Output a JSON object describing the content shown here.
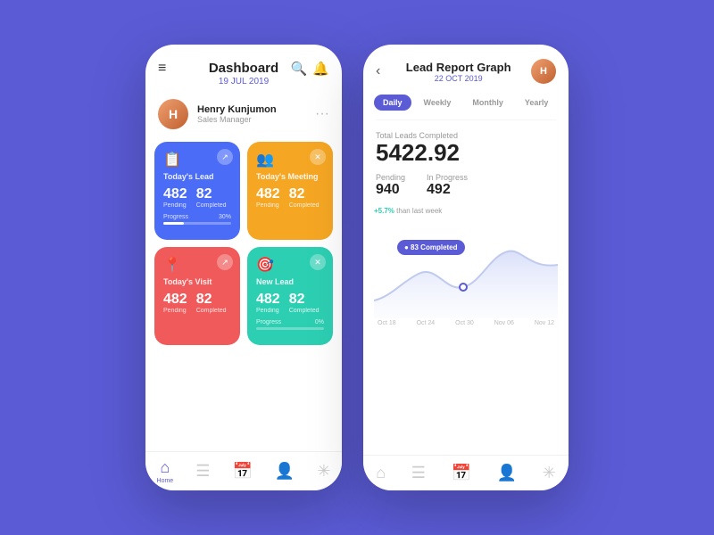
{
  "left_phone": {
    "header": {
      "title": "Dashboard",
      "date": "19 JUL 2019"
    },
    "profile": {
      "name": "Henry Kunjumon",
      "role": "Sales Manager",
      "avatar_initials": "H"
    },
    "cards": [
      {
        "id": "todays-lead",
        "title": "Today's Lead",
        "color": "blue",
        "pending": "482",
        "completed": "82",
        "progress_label": "Progress",
        "progress_pct": "30%",
        "progress_value": 30,
        "icon": "📋"
      },
      {
        "id": "todays-meeting",
        "title": "Today's Meeting",
        "color": "orange",
        "pending": "482",
        "completed": "82",
        "icon": "👥"
      },
      {
        "id": "todays-visit",
        "title": "Today's Visit",
        "color": "red",
        "pending": "482",
        "completed": "82",
        "icon": "📍"
      },
      {
        "id": "new-lead",
        "title": "New Lead",
        "color": "teal",
        "pending": "482",
        "completed": "82",
        "progress_label": "Progress",
        "progress_pct": "0%",
        "progress_value": 0,
        "icon": "🎯"
      }
    ],
    "nav_items": [
      {
        "id": "home",
        "label": "Home",
        "active": true,
        "icon": "⌂"
      },
      {
        "id": "docs",
        "label": "",
        "active": false,
        "icon": "☰"
      },
      {
        "id": "calendar",
        "label": "",
        "active": false,
        "icon": "📅"
      },
      {
        "id": "team",
        "label": "",
        "active": false,
        "icon": "👤"
      },
      {
        "id": "settings",
        "label": "",
        "active": false,
        "icon": "✳"
      }
    ]
  },
  "right_phone": {
    "header": {
      "title": "Lead Report Graph",
      "date": "22 OCT 2019",
      "avatar_initials": "H"
    },
    "filter_tabs": [
      {
        "label": "Daily",
        "active": true
      },
      {
        "label": "Weekly",
        "active": false
      },
      {
        "label": "Monthly",
        "active": false
      },
      {
        "label": "Yearly",
        "active": false
      }
    ],
    "total_leads": {
      "label": "Total Leads Completed",
      "value": "5422.92"
    },
    "sub_stats": [
      {
        "label": "Pending",
        "value": "940"
      },
      {
        "label": "In Progress",
        "value": "492"
      }
    ],
    "graph": {
      "growth_text": "+5.7% than last week",
      "completed_badge": "83 Completed",
      "x_labels": [
        "Oct 18",
        "Oct 24",
        "Oct 30",
        "Nov 06",
        "Nov 12"
      ]
    },
    "nav_items": [
      {
        "id": "home",
        "active": false,
        "icon": "⌂"
      },
      {
        "id": "docs",
        "active": false,
        "icon": "☰"
      },
      {
        "id": "calendar",
        "active": false,
        "icon": "📅"
      },
      {
        "id": "team",
        "active": false,
        "icon": "👤"
      },
      {
        "id": "settings",
        "active": false,
        "icon": "✳"
      }
    ]
  }
}
